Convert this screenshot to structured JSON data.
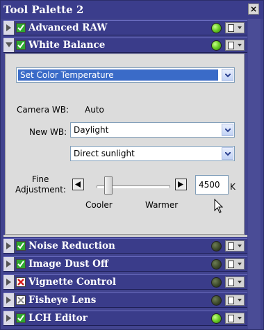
{
  "window": {
    "title": "Tool Palette 2",
    "close_label": "×"
  },
  "sections": [
    {
      "label": "Advanced RAW",
      "expanded": false,
      "checked": true,
      "status": "green"
    },
    {
      "label": "White Balance",
      "expanded": true,
      "checked": true,
      "status": "green"
    },
    {
      "label": "Noise Reduction",
      "expanded": false,
      "checked": true,
      "status": "dark"
    },
    {
      "label": "Image Dust Off",
      "expanded": false,
      "checked": true,
      "status": "dark"
    },
    {
      "label": "Vignette Control",
      "expanded": false,
      "checked": false,
      "check_mark": "red-x",
      "status": "dark"
    },
    {
      "label": "Fisheye Lens",
      "expanded": false,
      "checked": false,
      "check_mark": "gray-x",
      "status": "dark"
    },
    {
      "label": "LCH Editor",
      "expanded": false,
      "checked": true,
      "status": "green"
    }
  ],
  "white_balance": {
    "mode_select": "Set Color Temperature",
    "camera_wb_label": "Camera WB:",
    "camera_wb_value": "Auto",
    "new_wb_label": "New WB:",
    "new_wb_value": "Daylight",
    "sub_value": "Direct sunlight",
    "fine_adjustment_label_line1": "Fine",
    "fine_adjustment_label_line2": "Adjustment:",
    "temperature_value": "4500",
    "temperature_unit": "K",
    "cooler_label": "Cooler",
    "warmer_label": "Warmer"
  },
  "colors": {
    "title_bg": "#3b3d8c",
    "section_bg": "#3a3c8a",
    "panel_bg": "#dcdcdc",
    "selection_blue": "#3a6bc8",
    "status_green": "#6fd12a",
    "status_dark": "#3d4a2b"
  }
}
